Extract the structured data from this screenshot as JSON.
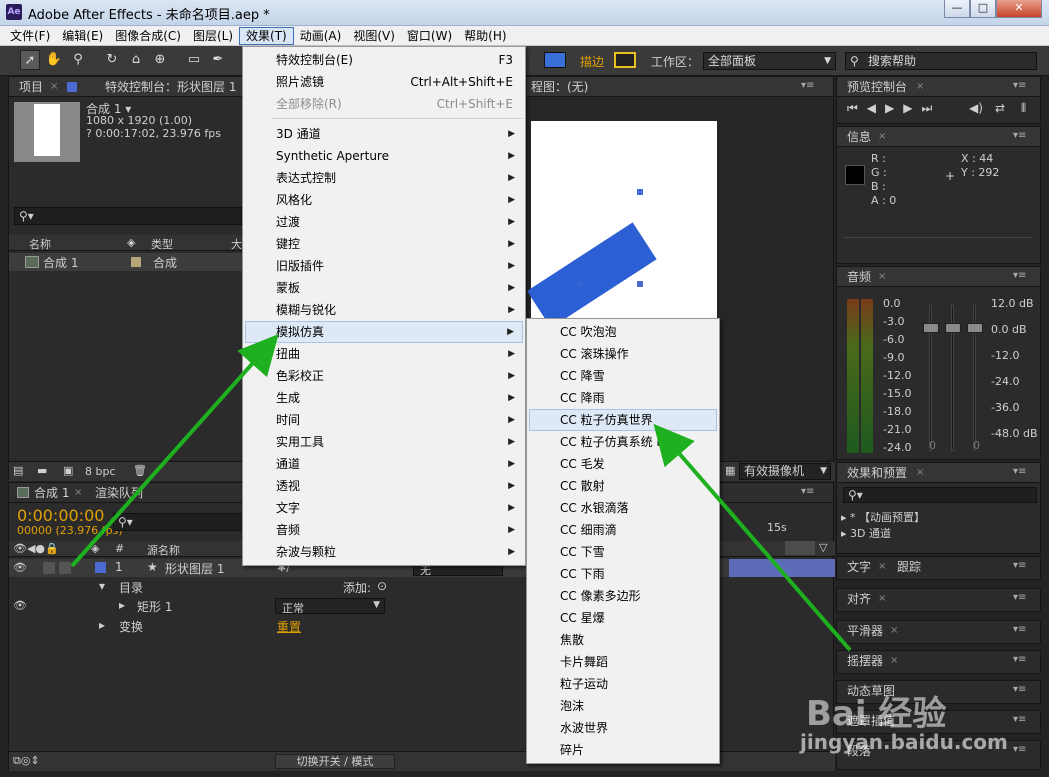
{
  "window": {
    "title": "Adobe After Effects - 未命名项目.aep *",
    "icon_text": "Ae",
    "min": "—",
    "max": "□",
    "close": "✕"
  },
  "menubar": [
    "文件(F)",
    "编辑(E)",
    "图像合成(C)",
    "图层(L)",
    "效果(T)",
    "动画(A)",
    "视图(V)",
    "窗口(W)",
    "帮助(H)"
  ],
  "toolbar": {
    "mask_feather_label": "描边",
    "workspace_label": "工作区：",
    "workspace_value": "全部面板",
    "search_placeholder": "搜索帮助",
    "colors": {
      "fill": "#3a6fd8",
      "stroke": "#e8c020"
    }
  },
  "project_panel": {
    "tab": "项目",
    "tab2": "特效控制台：形状图层 1",
    "comp_name": "合成 1 ▾",
    "comp_size": "1080 x 1920 (1.00)",
    "comp_duration": "? 0:00:17:02, 23.976 fps",
    "col_name": "名称",
    "col_type": "类型",
    "col_size": "大",
    "item_name": "合成 1",
    "item_type": "合成",
    "bpc": "8 bpc"
  },
  "comp_viewer": {
    "tab": "程图：(无)",
    "camera": "有效摄像机"
  },
  "timeline": {
    "tab": "合成 1",
    "tab2": "渲染队列",
    "timecode": "0:00:00:00",
    "frame_info": "00000 (23.976 fps)",
    "col_source": "源名称",
    "layer_num": "1",
    "layer_name": "形状图层 1",
    "parent_value": "无",
    "content": "目录",
    "add_label": "添加:",
    "rect": "矩形 1",
    "blend_mode": "正常",
    "transform": "变换",
    "reset": "重置",
    "ruler_mark": "15s",
    "footer": "切换开关 / 模式"
  },
  "effects_menu": [
    {
      "label": "特效控制台(E)",
      "shortcut": "F3"
    },
    {
      "label": "照片滤镜",
      "shortcut": "Ctrl+Alt+Shift+E"
    },
    {
      "label": "全部移除(R)",
      "shortcut": "Ctrl+Shift+E",
      "disabled": true
    },
    {
      "label": "3D 通道"
    },
    {
      "label": "Synthetic Aperture"
    },
    {
      "label": "表达式控制"
    },
    {
      "label": "风格化"
    },
    {
      "label": "过渡"
    },
    {
      "label": "键控"
    },
    {
      "label": "旧版插件"
    },
    {
      "label": "蒙板"
    },
    {
      "label": "模糊与锐化"
    },
    {
      "label": "模拟仿真",
      "highlighted": true
    },
    {
      "label": "扭曲"
    },
    {
      "label": "色彩校正"
    },
    {
      "label": "生成"
    },
    {
      "label": "时间"
    },
    {
      "label": "实用工具"
    },
    {
      "label": "通道"
    },
    {
      "label": "透视"
    },
    {
      "label": "文字"
    },
    {
      "label": "音频"
    },
    {
      "label": "杂波与颗粒"
    }
  ],
  "simulation_submenu": [
    "CC 吹泡泡",
    "CC 滚珠操作",
    "CC 降雪",
    "CC 降雨",
    "CC 粒子仿真世界",
    "CC 粒子仿真系统 II",
    "CC 毛发",
    "CC 散射",
    "CC 水银滴落",
    "CC 细雨滴",
    "CC 下雪",
    "CC 下雨",
    "CC 像素多边形",
    "CC 星爆",
    "焦散",
    "卡片舞蹈",
    "粒子运动",
    "泡沫",
    "水波世界",
    "碎片"
  ],
  "highlighted_submenu_item": "CC 粒子仿真世界",
  "right_panels": {
    "preview": "预览控制台",
    "info": "信息",
    "info_r": "R :",
    "info_g": "G :",
    "info_b": "B :",
    "info_a": "A : 0",
    "info_x": "X : 44",
    "info_y": "Y : 292",
    "audio": "音频",
    "audio_levels_left": [
      "0.0",
      "-3.0",
      "-6.0",
      "-9.0",
      "-12.0",
      "-15.0",
      "-18.0",
      "-21.0",
      "-24.0"
    ],
    "audio_levels_right": [
      "12.0 dB",
      "0.0 dB",
      "-12.0",
      "-24.0",
      "-36.0",
      "-48.0 dB"
    ],
    "audio_zero": "0",
    "effects_presets": "效果和预置",
    "preset_item1": "▸ * 【动画预置】",
    "preset_item2": "▸ 3D 通道",
    "text_tab": "文字",
    "track_tab": "跟踪",
    "align_tab": "对齐",
    "smoother_tab": "平滑器",
    "wiggler_tab": "摇摆器",
    "motion_tab": "动态草图",
    "mask_tab": "遮罩插值",
    "para_tab": "段落"
  },
  "watermark": {
    "brand": "Bai 经验",
    "url": "jingyan.baidu.com"
  }
}
